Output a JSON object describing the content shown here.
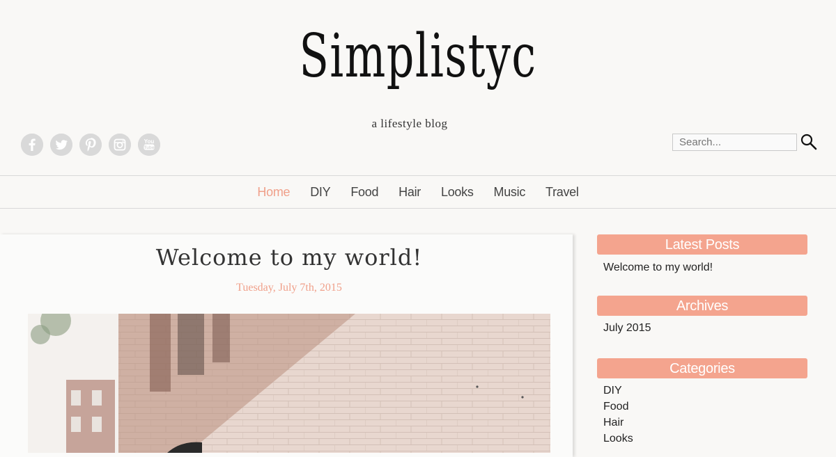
{
  "header": {
    "site_title": "Simplistyc",
    "tagline": "a lifestyle blog"
  },
  "social": [
    {
      "name": "facebook-icon",
      "glyph": "f"
    },
    {
      "name": "twitter-icon",
      "glyph": "t"
    },
    {
      "name": "pinterest-icon",
      "glyph": "p"
    },
    {
      "name": "instagram-icon",
      "glyph": "◎"
    },
    {
      "name": "youtube-icon",
      "glyph": "You Tube"
    }
  ],
  "search": {
    "placeholder": "Search...",
    "icon": "search-icon"
  },
  "nav": {
    "items": [
      "Home",
      "DIY",
      "Food",
      "Hair",
      "Looks",
      "Music",
      "Travel"
    ],
    "active": "Home"
  },
  "post": {
    "title": "Welcome to my world!",
    "date": "Tuesday, July 7th, 2015"
  },
  "sidebar": {
    "latest_posts": {
      "title": "Latest Posts",
      "items": [
        "Welcome to my world!"
      ]
    },
    "archives": {
      "title": "Archives",
      "items": [
        "July 2015"
      ]
    },
    "categories": {
      "title": "Categories",
      "items": [
        "DIY",
        "Food",
        "Hair",
        "Looks"
      ]
    }
  },
  "colors": {
    "accent": "#f4a48e",
    "nav_active": "#f0a08a",
    "background": "#f9f8f6"
  }
}
